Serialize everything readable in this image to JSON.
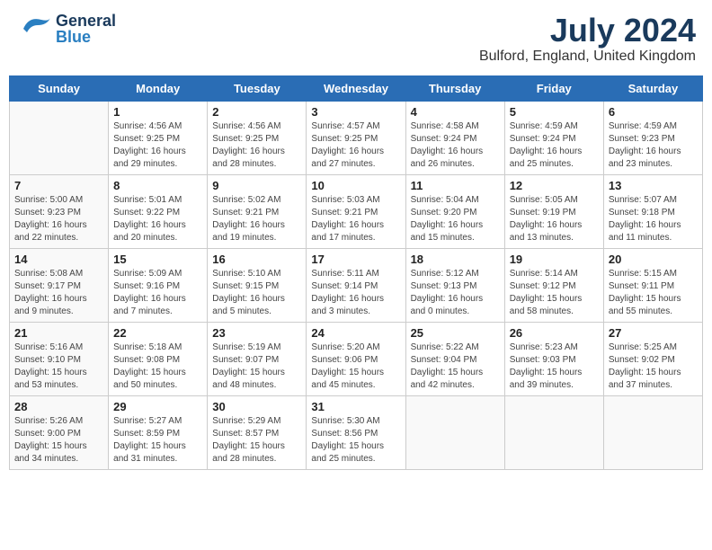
{
  "header": {
    "logo_general": "General",
    "logo_blue": "Blue",
    "month_year": "July 2024",
    "location": "Bulford, England, United Kingdom"
  },
  "days_of_week": [
    "Sunday",
    "Monday",
    "Tuesday",
    "Wednesday",
    "Thursday",
    "Friday",
    "Saturday"
  ],
  "weeks": [
    [
      {
        "day": "",
        "info": ""
      },
      {
        "day": "1",
        "info": "Sunrise: 4:56 AM\nSunset: 9:25 PM\nDaylight: 16 hours\nand 29 minutes."
      },
      {
        "day": "2",
        "info": "Sunrise: 4:56 AM\nSunset: 9:25 PM\nDaylight: 16 hours\nand 28 minutes."
      },
      {
        "day": "3",
        "info": "Sunrise: 4:57 AM\nSunset: 9:25 PM\nDaylight: 16 hours\nand 27 minutes."
      },
      {
        "day": "4",
        "info": "Sunrise: 4:58 AM\nSunset: 9:24 PM\nDaylight: 16 hours\nand 26 minutes."
      },
      {
        "day": "5",
        "info": "Sunrise: 4:59 AM\nSunset: 9:24 PM\nDaylight: 16 hours\nand 25 minutes."
      },
      {
        "day": "6",
        "info": "Sunrise: 4:59 AM\nSunset: 9:23 PM\nDaylight: 16 hours\nand 23 minutes."
      }
    ],
    [
      {
        "day": "7",
        "info": "Sunrise: 5:00 AM\nSunset: 9:23 PM\nDaylight: 16 hours\nand 22 minutes."
      },
      {
        "day": "8",
        "info": "Sunrise: 5:01 AM\nSunset: 9:22 PM\nDaylight: 16 hours\nand 20 minutes."
      },
      {
        "day": "9",
        "info": "Sunrise: 5:02 AM\nSunset: 9:21 PM\nDaylight: 16 hours\nand 19 minutes."
      },
      {
        "day": "10",
        "info": "Sunrise: 5:03 AM\nSunset: 9:21 PM\nDaylight: 16 hours\nand 17 minutes."
      },
      {
        "day": "11",
        "info": "Sunrise: 5:04 AM\nSunset: 9:20 PM\nDaylight: 16 hours\nand 15 minutes."
      },
      {
        "day": "12",
        "info": "Sunrise: 5:05 AM\nSunset: 9:19 PM\nDaylight: 16 hours\nand 13 minutes."
      },
      {
        "day": "13",
        "info": "Sunrise: 5:07 AM\nSunset: 9:18 PM\nDaylight: 16 hours\nand 11 minutes."
      }
    ],
    [
      {
        "day": "14",
        "info": "Sunrise: 5:08 AM\nSunset: 9:17 PM\nDaylight: 16 hours\nand 9 minutes."
      },
      {
        "day": "15",
        "info": "Sunrise: 5:09 AM\nSunset: 9:16 PM\nDaylight: 16 hours\nand 7 minutes."
      },
      {
        "day": "16",
        "info": "Sunrise: 5:10 AM\nSunset: 9:15 PM\nDaylight: 16 hours\nand 5 minutes."
      },
      {
        "day": "17",
        "info": "Sunrise: 5:11 AM\nSunset: 9:14 PM\nDaylight: 16 hours\nand 3 minutes."
      },
      {
        "day": "18",
        "info": "Sunrise: 5:12 AM\nSunset: 9:13 PM\nDaylight: 16 hours\nand 0 minutes."
      },
      {
        "day": "19",
        "info": "Sunrise: 5:14 AM\nSunset: 9:12 PM\nDaylight: 15 hours\nand 58 minutes."
      },
      {
        "day": "20",
        "info": "Sunrise: 5:15 AM\nSunset: 9:11 PM\nDaylight: 15 hours\nand 55 minutes."
      }
    ],
    [
      {
        "day": "21",
        "info": "Sunrise: 5:16 AM\nSunset: 9:10 PM\nDaylight: 15 hours\nand 53 minutes."
      },
      {
        "day": "22",
        "info": "Sunrise: 5:18 AM\nSunset: 9:08 PM\nDaylight: 15 hours\nand 50 minutes."
      },
      {
        "day": "23",
        "info": "Sunrise: 5:19 AM\nSunset: 9:07 PM\nDaylight: 15 hours\nand 48 minutes."
      },
      {
        "day": "24",
        "info": "Sunrise: 5:20 AM\nSunset: 9:06 PM\nDaylight: 15 hours\nand 45 minutes."
      },
      {
        "day": "25",
        "info": "Sunrise: 5:22 AM\nSunset: 9:04 PM\nDaylight: 15 hours\nand 42 minutes."
      },
      {
        "day": "26",
        "info": "Sunrise: 5:23 AM\nSunset: 9:03 PM\nDaylight: 15 hours\nand 39 minutes."
      },
      {
        "day": "27",
        "info": "Sunrise: 5:25 AM\nSunset: 9:02 PM\nDaylight: 15 hours\nand 37 minutes."
      }
    ],
    [
      {
        "day": "28",
        "info": "Sunrise: 5:26 AM\nSunset: 9:00 PM\nDaylight: 15 hours\nand 34 minutes."
      },
      {
        "day": "29",
        "info": "Sunrise: 5:27 AM\nSunset: 8:59 PM\nDaylight: 15 hours\nand 31 minutes."
      },
      {
        "day": "30",
        "info": "Sunrise: 5:29 AM\nSunset: 8:57 PM\nDaylight: 15 hours\nand 28 minutes."
      },
      {
        "day": "31",
        "info": "Sunrise: 5:30 AM\nSunset: 8:56 PM\nDaylight: 15 hours\nand 25 minutes."
      },
      {
        "day": "",
        "info": ""
      },
      {
        "day": "",
        "info": ""
      },
      {
        "day": "",
        "info": ""
      }
    ]
  ]
}
